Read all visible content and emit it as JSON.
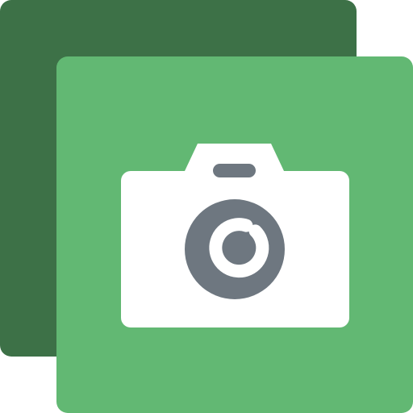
{
  "icon": {
    "name": "gallery-camera-icon",
    "colors": {
      "back_card": "#3d7147",
      "front_card": "#62b873",
      "camera_body": "#ffffff",
      "lens": "#6e7780"
    }
  }
}
